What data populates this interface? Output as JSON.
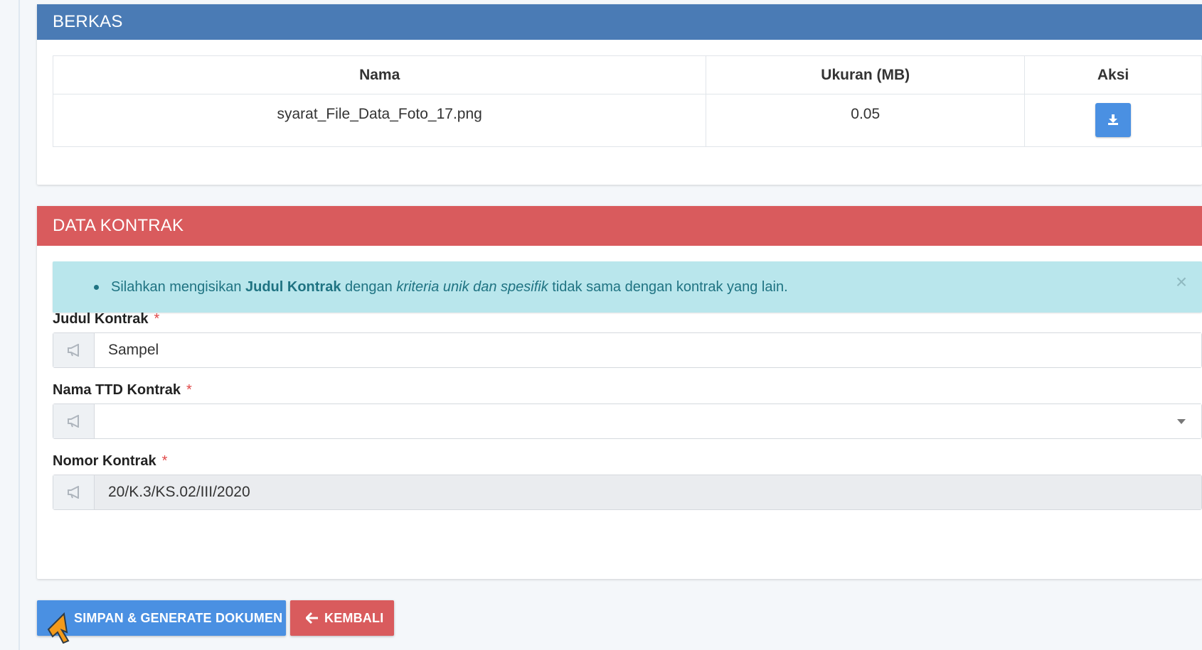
{
  "berkas": {
    "title": "BERKAS",
    "columns": [
      "Nama",
      "Ukuran (MB)",
      "Aksi"
    ],
    "rows": [
      {
        "nama": "syarat_File_Data_Foto_17.png",
        "ukuran": "0.05",
        "aksi_icon": "download-icon"
      }
    ]
  },
  "kontrak": {
    "title": "DATA KONTRAK",
    "alert": {
      "prefix": "Silahkan mengisikan ",
      "bold": "Judul Kontrak",
      "middle": " dengan ",
      "italic": "kriteria unik dan spesifik",
      "suffix": " tidak sama dengan kontrak yang lain.",
      "close_icon": "close-icon"
    },
    "fields": {
      "judul": {
        "label": "Judul Kontrak",
        "required": "*",
        "value": "Sampel",
        "icon": "megaphone-icon"
      },
      "ttd": {
        "label": "Nama TTD Kontrak",
        "required": "*",
        "value": "",
        "icon": "megaphone-icon"
      },
      "nomor": {
        "label": "Nomor Kontrak",
        "required": "*",
        "value": "20/K.3/KS.02/III/2020",
        "icon": "megaphone-icon"
      }
    }
  },
  "actions": {
    "save": "SIMPAN & GENERATE DOKUMEN",
    "back": "KEMBALI"
  },
  "colors": {
    "berkas_header": "#4a7bb5",
    "kontrak_header": "#d95b5d",
    "primary_button": "#4a90e2",
    "danger_button": "#d95b5d",
    "alert_bg": "#b9e6ec"
  }
}
